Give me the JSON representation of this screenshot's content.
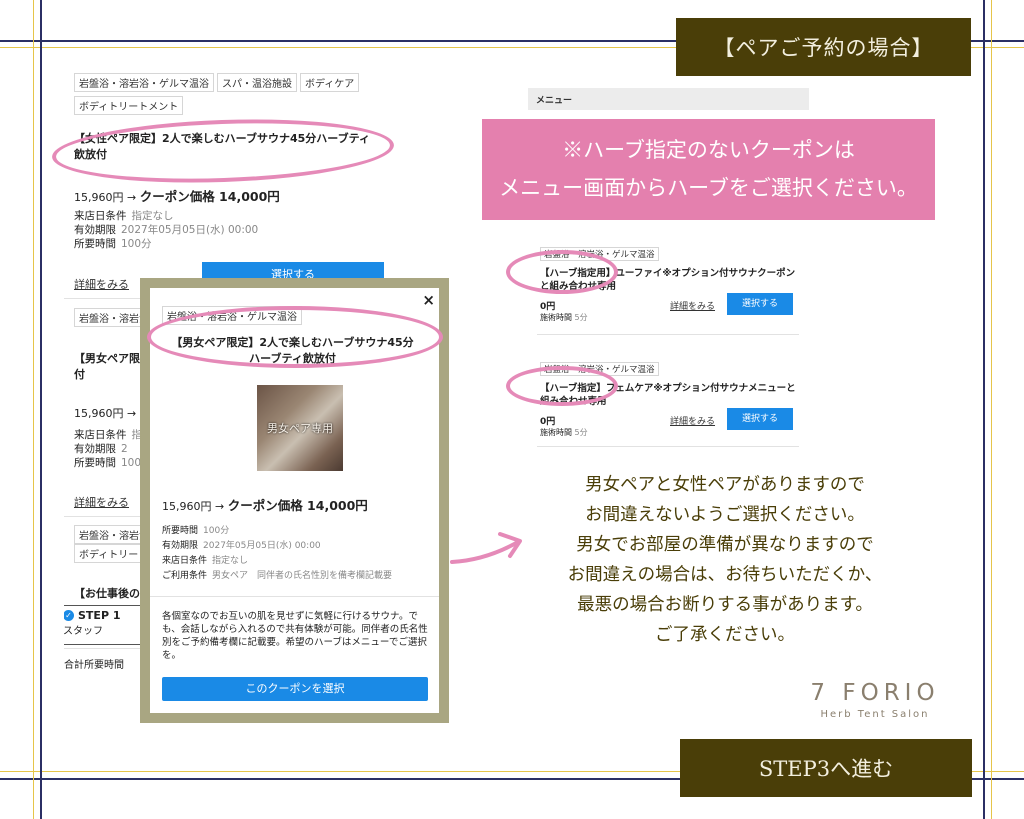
{
  "headers": {
    "pair_booking": "【ペアご予約の場合】",
    "step3": "STEP3へ進む"
  },
  "left_list": {
    "card1": {
      "tags": [
        "岩盤浴・溶岩浴・ゲルマ温浴",
        "スパ・温浴施設",
        "ボディケア",
        "ボディトリートメント"
      ],
      "title": "【女性ペア限定】2人で楽しむハーブサウナ45分ハーブティ飲放付",
      "price_orig": "15,960円 →",
      "price_coupon": "クーポン価格 14,000円",
      "cond1_label": "来店日条件",
      "cond1_value": "指定なし",
      "cond2_label": "有効期限",
      "cond2_value": "2027年05月05日(水) 00:00",
      "cond3_label": "所要時間",
      "cond3_value": "100分",
      "detail": "詳細をみる",
      "select": "選択する"
    },
    "card2": {
      "tag": "岩盤浴・溶岩浴",
      "title_line1": "【男女ペア限定",
      "title_line2": "付",
      "price_orig": "15,960円 →",
      "cond1_label": "来店日条件",
      "cond1_value": "指",
      "cond2_label": "有効期限",
      "cond2_value": "2",
      "cond3_label": "所要時間",
      "cond3_value": "100",
      "detail": "詳細をみる"
    },
    "card3": {
      "tag1": "岩盤浴・溶岩浴",
      "tag2": "ボディトリート",
      "title": "【お仕事後の"
    },
    "step": {
      "label": "STEP 1",
      "sub": "スタッフ"
    },
    "total": "合計所要時間"
  },
  "popup": {
    "tag": "岩盤浴・溶岩浴・ゲルマ温浴",
    "title": "【男女ペア限定】2人で楽しむハーブサウナ45分ハーブティ飲放付",
    "image_text": "男女ペア専用",
    "price_orig": "15,960円 →",
    "price_coupon": "クーポン価格 14,000円",
    "rows": [
      {
        "label": "所要時間",
        "value": "100分"
      },
      {
        "label": "有効期限",
        "value": "2027年05月05日(水) 00:00"
      },
      {
        "label": "来店日条件",
        "value": "指定なし"
      },
      {
        "label": "ご利用条件",
        "value": "男女ペア　同伴者の氏名性別を備考欄記載要"
      }
    ],
    "desc": "各個室なのでお互いの肌を見せずに気軽に行けるサウナ。でも、会話しながら入れるので共有体験が可能。同伴者の氏名性別をご予約備考欄に記載要。希望のハーブはメニューでご選択を。",
    "button": "このクーポンを選択",
    "close": "×"
  },
  "right": {
    "menu_label": "メニュー",
    "notice_line1": "※ハーブ指定のないクーポンは",
    "notice_line2": "メニュー画面からハーブをご選択ください。",
    "items": [
      {
        "tag": "岩盤浴・溶岩浴・ゲルマ温浴",
        "title": "【ハーブ指定用】ユーファイ※オプション付サウナクーポンと組み合わせ専用",
        "price": "0円",
        "time_label": "施術時間",
        "time_value": "5分",
        "detail": "詳細をみる",
        "select": "選択する"
      },
      {
        "tag": "岩盤浴・溶岩浴・ゲルマ温浴",
        "title": "【ハーブ指定】フェムケア※オプション付サウナメニューと組み合わせ専用",
        "price": "0円",
        "time_label": "施術時間",
        "time_value": "5分",
        "detail": "詳細をみる",
        "select": "選択する"
      }
    ]
  },
  "message": {
    "line1": "男女ペアと女性ペアがありますので",
    "line2": "お間違えないようご選択ください。",
    "line3": "男女でお部屋の準備が異なりますので",
    "line4": "お間違えの場合は、お待ちいただくか、",
    "line5": "最悪の場合お断りする事があります。",
    "line6": "ご了承ください。"
  },
  "logo": {
    "name": "7 FORIO",
    "tagline": "Herb Tent Salon"
  },
  "colors": {
    "navy": "#2b2f64",
    "gold": "#e6c54a",
    "olive": "#4a3e08",
    "pink": "#e480ae",
    "blue": "#1a8ae6",
    "highlight": "#e58ab8"
  }
}
